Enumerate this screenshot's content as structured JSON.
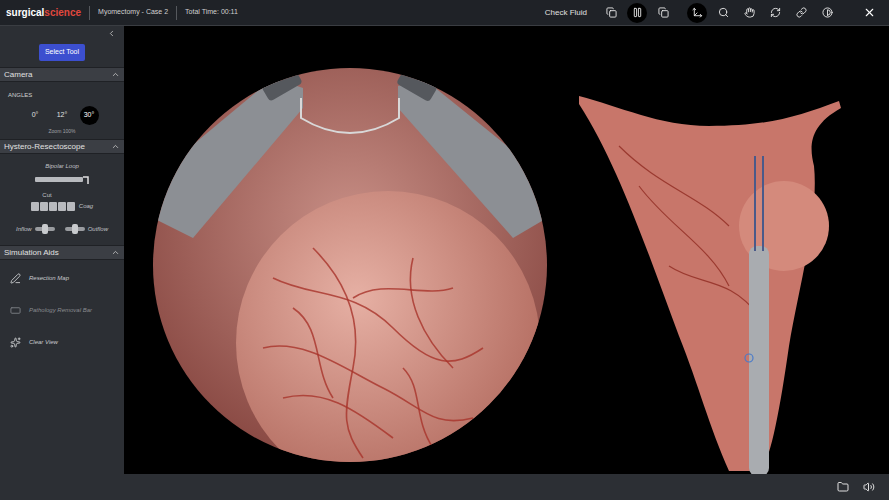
{
  "app": {
    "logo_primary": "surgical",
    "logo_secondary": "science",
    "case": "Myomectomy - Case 2",
    "timer": "Total Time: 00:11"
  },
  "toolbar": {
    "check_fluid": "Check Fluid",
    "tools": [
      {
        "kind": "copy",
        "selected": false
      },
      {
        "kind": "pause",
        "selected": true
      },
      {
        "kind": "copy",
        "selected": false
      },
      {
        "kind": "move",
        "selected": true
      },
      {
        "kind": "zoom",
        "selected": false
      },
      {
        "kind": "hand",
        "selected": false
      },
      {
        "kind": "rotate",
        "selected": false
      },
      {
        "kind": "link",
        "selected": false
      },
      {
        "kind": "contrast",
        "selected": false
      }
    ]
  },
  "sidebar": {
    "select_tool": "Select Tool",
    "camera": {
      "title": "Camera",
      "label": "ANGLES",
      "angles": [
        {
          "label": "0°",
          "selected": false
        },
        {
          "label": "12°",
          "selected": false
        },
        {
          "label": "30°",
          "selected": true
        }
      ],
      "zoom": "Zoom 100%"
    },
    "resectoscope": {
      "title": "Hystero-Resectoscope",
      "tool": "Bipolar Loop",
      "cut": "Cut",
      "coag": "Coag",
      "segments": [
        {
          "selected": false
        },
        {
          "selected": false
        },
        {
          "selected": false
        },
        {
          "selected": false
        },
        {
          "selected": false
        }
      ],
      "inflow": "Inflow",
      "outflow": "Outflow"
    },
    "aids": {
      "title": "Simulation Aids",
      "items": [
        {
          "label": "Resection Map",
          "kind": "map",
          "disabled": false
        },
        {
          "label": "Pathology Removal Bar",
          "kind": "bar",
          "disabled": true
        },
        {
          "label": "Clear View",
          "kind": "clear",
          "disabled": false
        }
      ]
    }
  }
}
